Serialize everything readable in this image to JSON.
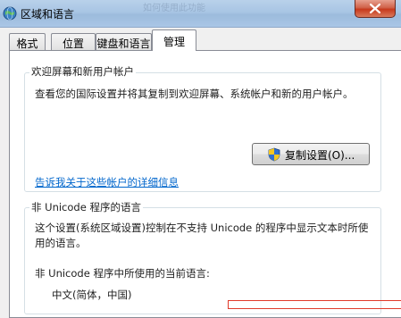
{
  "window": {
    "title": "区域和语言",
    "ghost_text": "如何使用此功能",
    "close_icon": "close-icon",
    "title_icon": "globe-icon"
  },
  "tabs": [
    {
      "label": "格式"
    },
    {
      "label": "位置"
    },
    {
      "label": "键盘和语言"
    },
    {
      "label": "管理",
      "active": true
    }
  ],
  "welcome_group": {
    "title": "欢迎屏幕和新用户帐户",
    "description": "查看您的国际设置并将其复制到欢迎屏幕、系统帐户和新的用户帐户。",
    "copy_button_label": "复制设置(O)...",
    "link_text": "告诉我关于这些帐户的详细信息"
  },
  "unicode_group": {
    "title": "非 Unicode 程序的语言",
    "description_line1": "这个设置(系统区域设置)控制在不支持 Unicode 的程序中显示文本时所使",
    "description_line2": "用的语言。",
    "current_label": "非 Unicode 程序中所使用的当前语言:",
    "current_value": "中文(简体，中国)"
  },
  "colors": {
    "link": "#0066cc",
    "highlight_border": "#e03a2a"
  }
}
